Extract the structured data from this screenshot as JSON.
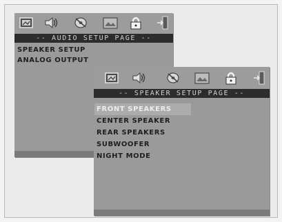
{
  "audio_setup": {
    "title": "-- AUDIO SETUP PAGE --",
    "icons": [
      "monitor-icon",
      "speaker-icon",
      "disc-icon",
      "picture-icon",
      "lock-icon",
      "exit-icon"
    ],
    "items": [
      "SPEAKER SETUP",
      "ANALOG OUTPUT"
    ]
  },
  "speaker_setup": {
    "title": "-- SPEAKER SETUP PAGE --",
    "icons": [
      "monitor-icon",
      "speaker-icon",
      "disc-icon",
      "picture-icon",
      "lock-icon",
      "exit-icon"
    ],
    "items": [
      "FRONT SPEAKERS",
      "CENTER SPEAKER",
      "REAR SPEAKERS",
      "SUBWOOFER",
      "NIGHT MODE"
    ],
    "selected_index": 0
  }
}
